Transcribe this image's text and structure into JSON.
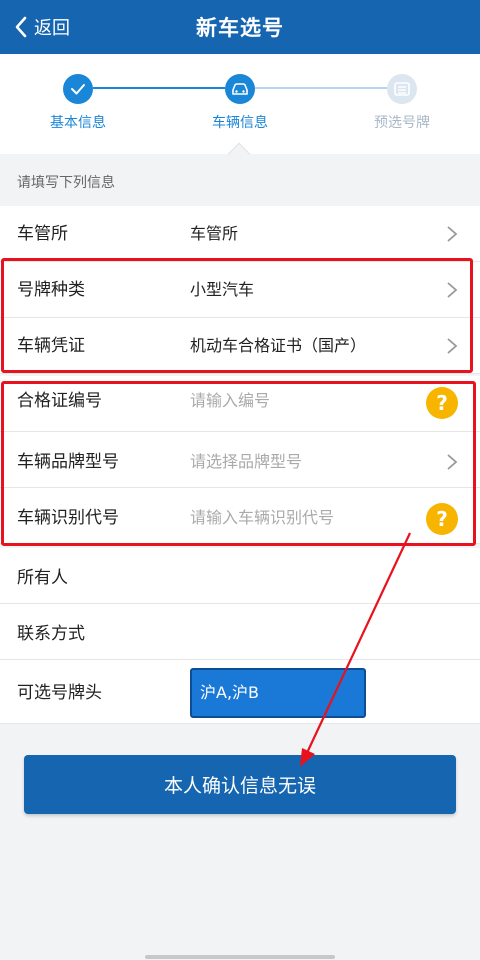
{
  "header": {
    "back_label": "返回",
    "title": "新车选号"
  },
  "steps": [
    {
      "label": "基本信息",
      "status": "done",
      "icon": "check-icon"
    },
    {
      "label": "车辆信息",
      "status": "current",
      "icon": "car-icon"
    },
    {
      "label": "预选号牌",
      "status": "pending",
      "icon": "plate-icon"
    }
  ],
  "section_hint": "请填写下列信息",
  "form": {
    "rows": [
      {
        "label": "车管所",
        "value": "车管所",
        "accessory": "chevron"
      },
      {
        "label": "号牌种类",
        "value": "小型汽车",
        "accessory": "chevron"
      },
      {
        "label": "车辆凭证",
        "value": "机动车合格证书（国产）",
        "accessory": "chevron"
      },
      {
        "label": "合格证编号",
        "placeholder": "请输入编号",
        "accessory": "help"
      },
      {
        "label": "车辆品牌型号",
        "placeholder": "请选择品牌型号",
        "accessory": "chevron"
      },
      {
        "label": "车辆识别代号",
        "placeholder": "请输入车辆识别代号",
        "accessory": "help"
      },
      {
        "label": "所有人",
        "value": ""
      },
      {
        "label": "联系方式",
        "value": ""
      },
      {
        "label": "可选号牌头",
        "value": "沪A,沪B"
      }
    ],
    "help_symbol": "?"
  },
  "confirm_button": "本人确认信息无误",
  "colors": {
    "primary": "#1565b0",
    "highlight_red": "#e8121e",
    "help_yellow": "#f7b500",
    "step_active": "#1a86d8",
    "step_pending": "#b8c9db"
  }
}
